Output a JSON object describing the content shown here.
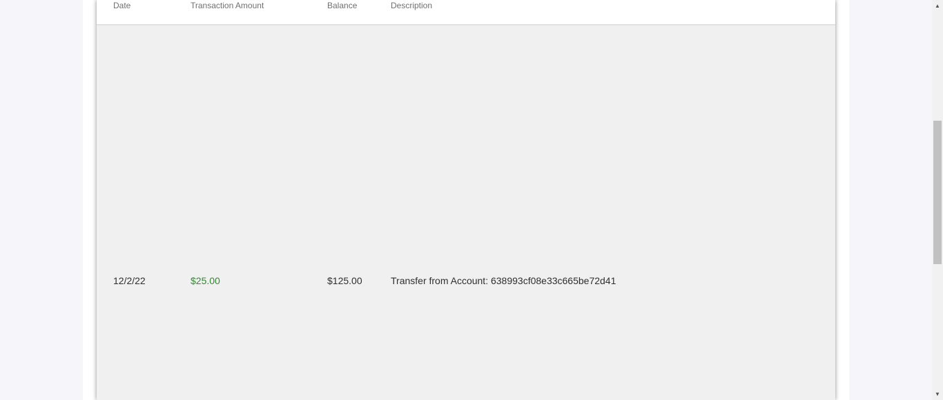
{
  "table": {
    "headers": {
      "date": "Date",
      "amount": "Transaction Amount",
      "balance": "Balance",
      "description": "Description"
    },
    "rows": [
      {
        "date": "12/2/22",
        "amount": "$25.00",
        "balance": "$125.00",
        "description": "Transfer from Account: 638993cf08e33c665be72d41"
      }
    ]
  },
  "colors": {
    "positive_amount": "#2e8b2e",
    "card_background": "#f0f0f0",
    "page_background": "#f6f6fa"
  },
  "scrollbar": {
    "up_icon": "triangle-up-icon",
    "down_icon": "triangle-down-icon"
  }
}
